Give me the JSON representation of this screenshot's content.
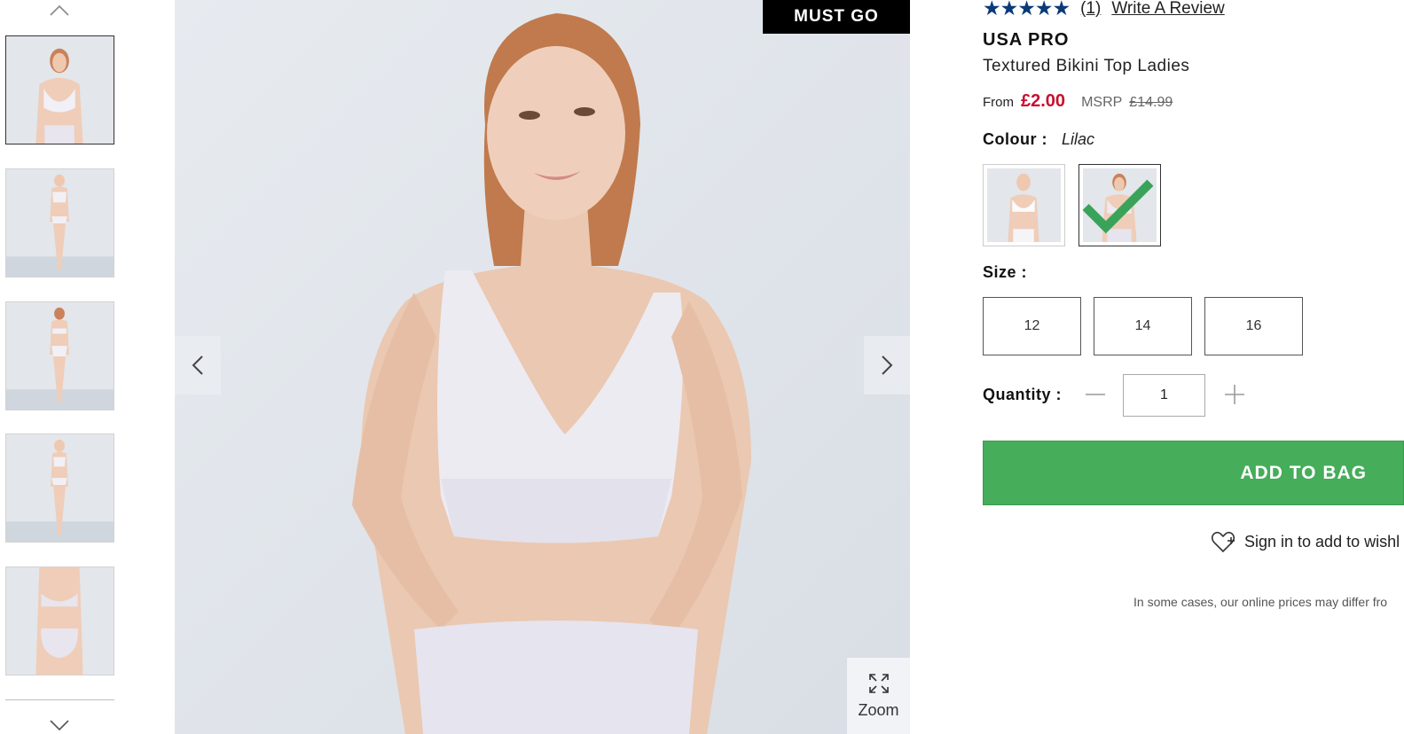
{
  "gallery": {
    "badge": "MUST GO",
    "zoom_label": "Zoom",
    "thumbnail_count": 5,
    "active_thumbnail": 1
  },
  "product": {
    "rating_stars": "★★★★★",
    "rating_value": 5,
    "review_count": "(1)",
    "write_review": "Write A Review",
    "brand": "USA PRO",
    "name": "Textured Bikini Top Ladies",
    "price_from_label": "From",
    "price": "£2.00",
    "msrp_label": "MSRP",
    "msrp_price": "£14.99",
    "colour_label": "Colour :",
    "colour_value": "Lilac",
    "colour_swatches": [
      "white",
      "lilac"
    ],
    "selected_colour_index": 2,
    "size_label": "Size :",
    "sizes": [
      "12",
      "14",
      "16"
    ],
    "quantity_label": "Quantity :",
    "quantity_value": "1",
    "add_to_bag": "ADD TO BAG",
    "wishlist": "Sign in to add to wishl",
    "disclaimer": "In some cases, our online prices may differ fro"
  },
  "colors": {
    "price_red": "#c8102e",
    "add_to_bag_green": "#46ad5a",
    "star_blue": "#0b3a78",
    "check_green": "#3aa35a",
    "badge_black": "#000000"
  },
  "icons": [
    "chevron-up-icon",
    "chevron-down-icon",
    "chevron-left-icon",
    "chevron-right-icon",
    "expand-icon",
    "minus-icon",
    "plus-icon",
    "heart-plus-icon",
    "check-icon",
    "star-icon"
  ]
}
